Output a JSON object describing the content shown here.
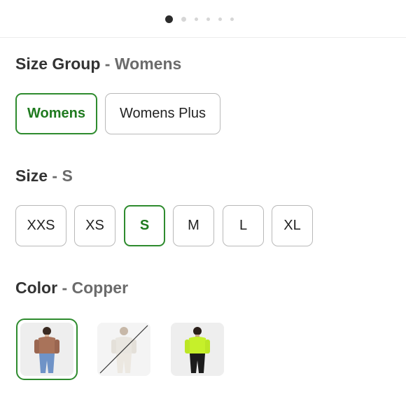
{
  "carousel": {
    "count": 6,
    "active": 0
  },
  "size_group": {
    "title": "Size Group",
    "separator": "-",
    "selected_value": "Womens",
    "options": [
      "Womens",
      "Womens Plus"
    ]
  },
  "size": {
    "title": "Size",
    "separator": "-",
    "selected_value": "S",
    "options": [
      "XXS",
      "XS",
      "S",
      "M",
      "L",
      "XL"
    ]
  },
  "color": {
    "title": "Color",
    "separator": "-",
    "selected_value": "Copper",
    "swatches": [
      "copper-top-swatch",
      "unavailable-white-swatch",
      "lime-top-swatch"
    ]
  },
  "colors": {
    "accent": "#2e8b2e",
    "border": "#b9b9b9",
    "text": "#333333",
    "muted": "#6b6b6b"
  }
}
